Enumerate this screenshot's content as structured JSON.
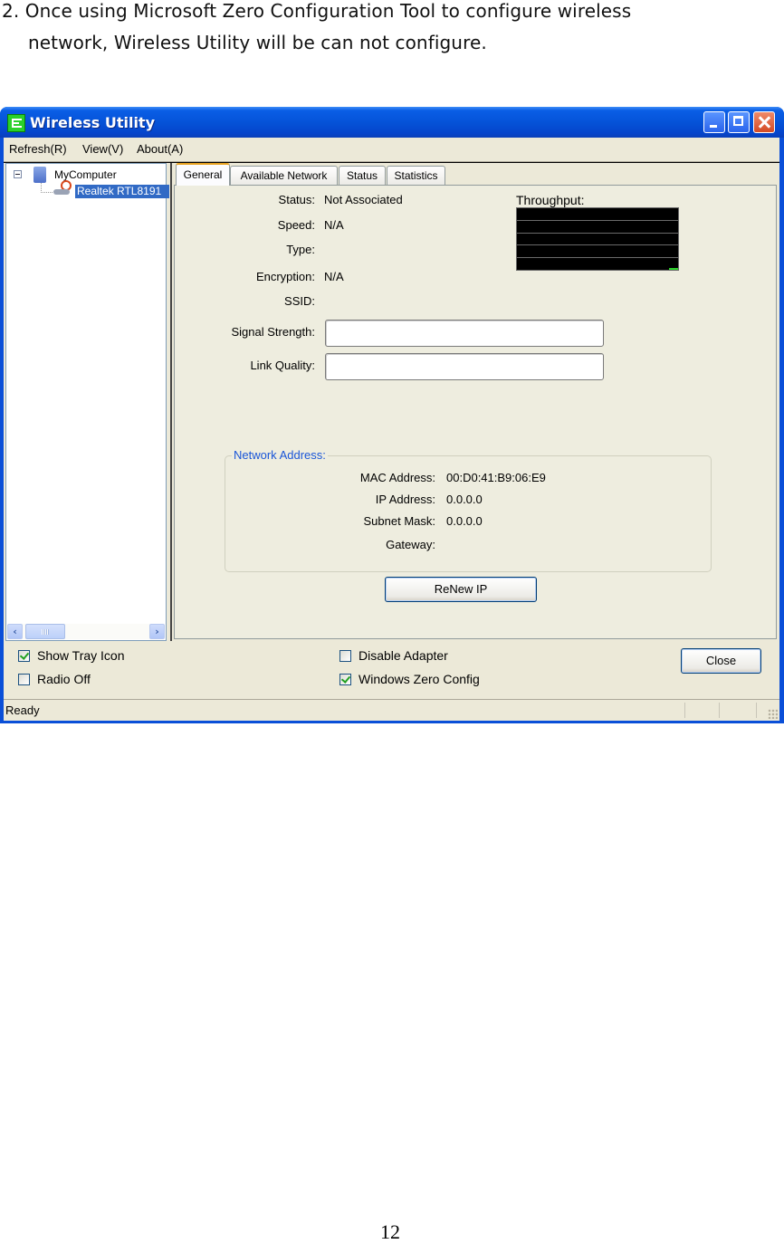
{
  "document": {
    "paragraph_line1": "2. Once using Microsoft Zero Configuration Tool to configure wireless",
    "paragraph_line2": "network, Wireless Utility will be can not configure.",
    "page_number": "12"
  },
  "window": {
    "title": "Wireless Utility",
    "controls": {
      "minimize": "minimize-icon",
      "maximize": "maximize-icon",
      "close": "close-icon"
    }
  },
  "menu": [
    "Refresh(R)",
    "View(V)",
    "About(A)"
  ],
  "tree": {
    "root": "MyComputer",
    "child": "Realtek RTL8191"
  },
  "tabs": [
    "General",
    "Available Network",
    "Status",
    "Statistics"
  ],
  "active_tab": "General",
  "general": {
    "status_label": "Status:",
    "status_value": "Not Associated",
    "speed_label": "Speed:",
    "speed_value": "N/A",
    "type_label": "Type:",
    "type_value": "",
    "encryption_label": "Encryption:",
    "encryption_value": "N/A",
    "ssid_label": "SSID:",
    "ssid_value": "",
    "signal_label": "Signal Strength:",
    "signal_value_percent": 0,
    "link_label": "Link Quality:",
    "link_value_percent": 0,
    "throughput_label": "Throughput:"
  },
  "network_address": {
    "title": "Network Address:",
    "mac_label": "MAC Address:",
    "mac_value": "00:D0:41:B9:06:E9",
    "ip_label": "IP Address:",
    "ip_value": "0.0.0.0",
    "subnet_label": "Subnet Mask:",
    "subnet_value": "0.0.0.0",
    "gateway_label": "Gateway:",
    "gateway_value": "",
    "renew_button": "ReNew IP"
  },
  "options": {
    "show_tray_icon": {
      "label": "Show Tray Icon",
      "checked": true
    },
    "radio_off": {
      "label": "Radio Off",
      "checked": false
    },
    "disable_adapter": {
      "label": "Disable Adapter",
      "checked": false
    },
    "windows_zero_config": {
      "label": "Windows Zero Config",
      "checked": true
    },
    "close_button": "Close"
  },
  "statusbar": {
    "text": "Ready"
  },
  "colors": {
    "titlebar": "#0553d8",
    "selection": "#316ac5",
    "group_title": "#1a56d8",
    "graph_bg": "#000000",
    "graph_trace": "#2bd42b"
  }
}
